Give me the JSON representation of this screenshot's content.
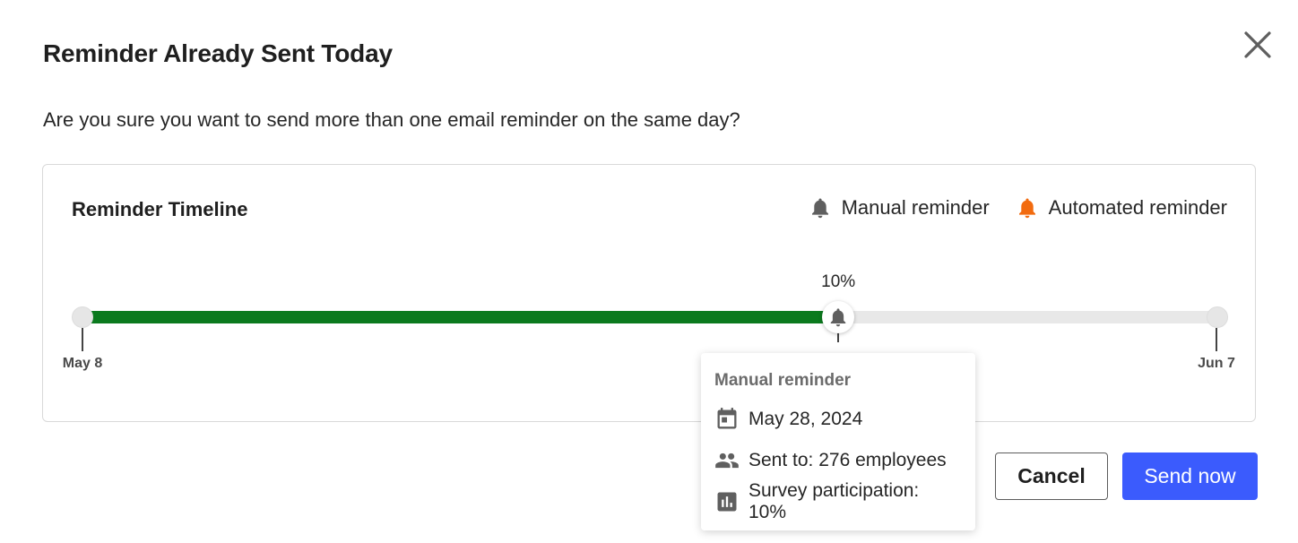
{
  "dialog": {
    "title": "Reminder Already Sent Today",
    "message": "Are you sure you want to send more than one email reminder on the same day?"
  },
  "timeline": {
    "title": "Reminder Timeline",
    "legend": [
      {
        "label": "Manual reminder",
        "icon": "bell-icon",
        "color": "#5f5f5f"
      },
      {
        "label": "Automated reminder",
        "icon": "bell-icon",
        "color": "#f26b0f"
      }
    ],
    "start_label": "May 8",
    "end_label": "Jun 7",
    "progress_fraction": 0.666,
    "progress_color": "#0b7a1e",
    "marker": {
      "percent_label": "10%",
      "position_fraction": 0.666,
      "icon": "bell-icon"
    }
  },
  "tooltip": {
    "title": "Manual reminder",
    "date": "May 28, 2024",
    "sent_to": "Sent to: 276 employees",
    "participation": "Survey participation: 10%"
  },
  "actions": {
    "cancel_label": "Cancel",
    "send_label": "Send now",
    "send_color": "#3b5bfd"
  }
}
